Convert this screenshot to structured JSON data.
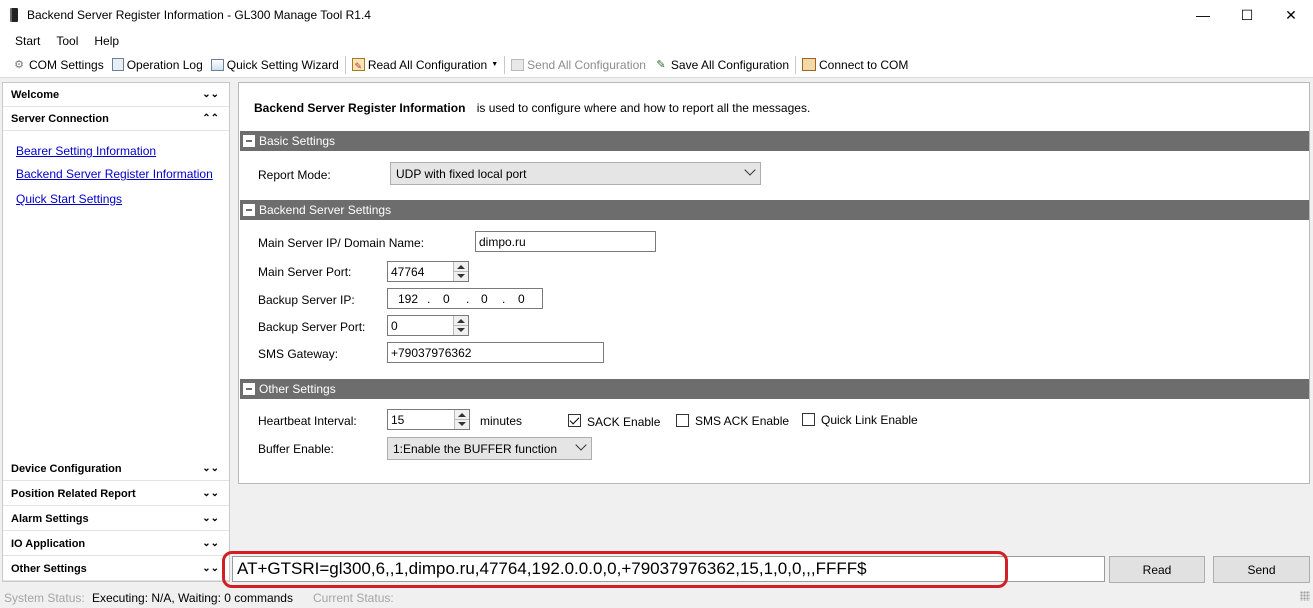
{
  "window": {
    "title": "Backend Server Register Information - GL300 Manage Tool R1.4",
    "minimize": "—",
    "maximize": "☐",
    "close": "✕"
  },
  "menu": [
    "Start",
    "Tool",
    "Help"
  ],
  "toolbar": {
    "com_settings": "COM Settings",
    "operation_log": "Operation Log",
    "quick_setting_wizard": "Quick Setting Wizard",
    "read_all": "Read All Configuration",
    "send_all": "Send All Configuration",
    "save_all": "Save All Configuration",
    "connect_com": "Connect to COM"
  },
  "nav": {
    "welcome": "Welcome",
    "server_connection": "Server Connection",
    "links": [
      "Bearer Setting Information",
      "Backend Server Register Information",
      "Quick Start Settings"
    ],
    "device_configuration": "Device Configuration",
    "position_related_report": "Position Related Report",
    "alarm_settings": "Alarm Settings",
    "io_application": "IO Application",
    "other_settings": "Other Settings"
  },
  "main": {
    "intro_bold": "Backend Server Register Information",
    "intro_text": "is used to configure where and how to report all the messages.",
    "basic": {
      "title": "Basic Settings",
      "report_mode_label": "Report Mode:",
      "report_mode_value": "UDP with fixed local port"
    },
    "backend": {
      "title": "Backend Server Settings",
      "main_ip_label": "Main Server IP/ Domain Name:",
      "main_ip_value": "dimpo.ru",
      "main_port_label": "Main Server Port:",
      "main_port_value": "47764",
      "backup_ip_label": "Backup Server IP:",
      "backup_ip": [
        "192",
        "0",
        "0",
        "0"
      ],
      "backup_port_label": "Backup Server Port:",
      "backup_port_value": "0",
      "sms_gateway_label": "SMS Gateway:",
      "sms_gateway_value": "+79037976362"
    },
    "other": {
      "title": "Other Settings",
      "heartbeat_label": "Heartbeat Interval:",
      "heartbeat_value": "15",
      "heartbeat_unit": "minutes",
      "sack_enable": "SACK Enable",
      "sms_ack_enable": "SMS ACK Enable",
      "quick_link_enable": "Quick Link Enable",
      "buffer_label": "Buffer Enable:",
      "buffer_value": "1:Enable the BUFFER function"
    }
  },
  "command": {
    "text": "AT+GTSRI=gl300,6,,1,dimpo.ru,47764,192.0.0.0,0,+79037976362,15,1,0,0,,,FFFF$",
    "read": "Read",
    "send": "Send"
  },
  "status": {
    "system_status_label": "System Status:",
    "executing": "Executing: N/A, Waiting: 0 commands",
    "current_status_label": "Current Status:"
  }
}
